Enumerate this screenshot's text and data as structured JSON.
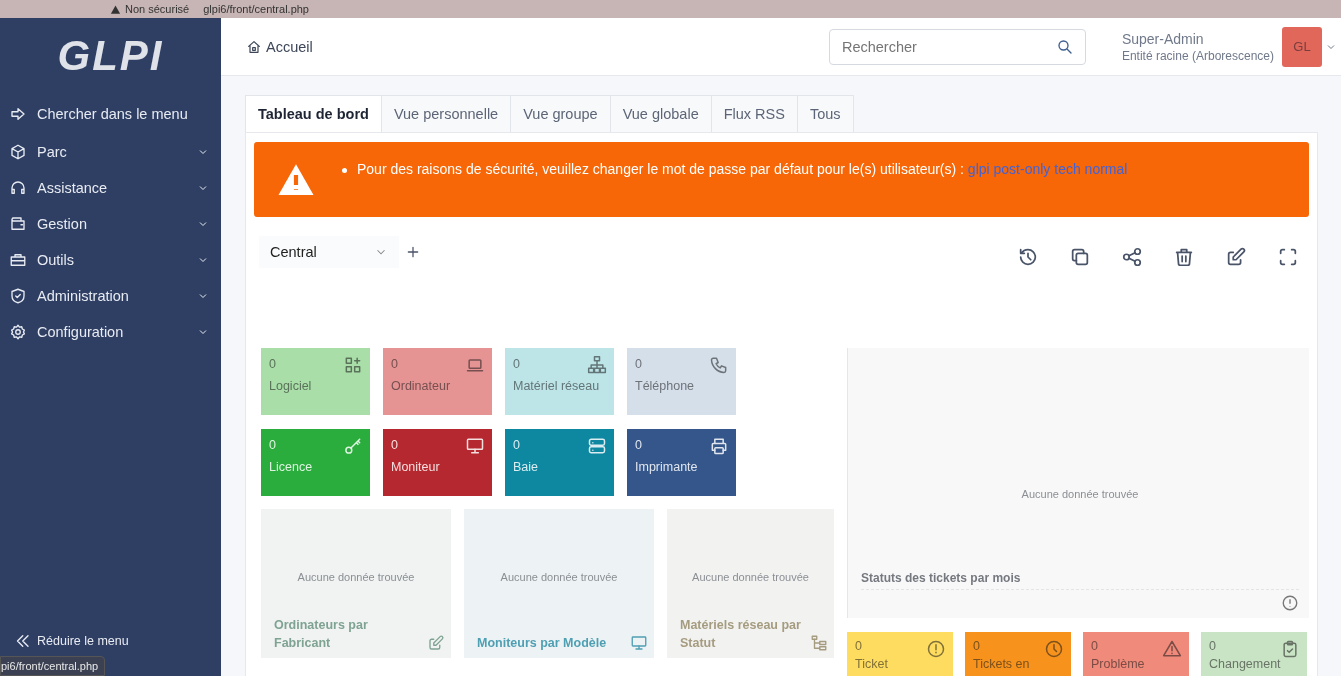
{
  "browser": {
    "security_label": "Non sécurisé",
    "url": "glpi6/front/central.php"
  },
  "sidebar": {
    "logo": "GLPI",
    "search_label": "Chercher dans le menu",
    "items": [
      {
        "label": "Parc"
      },
      {
        "label": "Assistance"
      },
      {
        "label": "Gestion"
      },
      {
        "label": "Outils"
      },
      {
        "label": "Administration"
      },
      {
        "label": "Configuration"
      }
    ],
    "collapse_label": "Réduire le menu"
  },
  "header": {
    "breadcrumb": "Accueil",
    "search": {
      "placeholder": "Rechercher"
    },
    "user_name": "Super-Admin",
    "entity": "Entité racine (Arborescence)",
    "avatar_initials": "GL"
  },
  "tabs": [
    {
      "label": "Tableau de bord",
      "selected": true
    },
    {
      "label": "Vue personnelle",
      "selected": false
    },
    {
      "label": "Vue groupe",
      "selected": false
    },
    {
      "label": "Vue globale",
      "selected": false
    },
    {
      "label": "Flux RSS",
      "selected": false
    },
    {
      "label": "Tous",
      "selected": false
    }
  ],
  "alert": {
    "message": "Pour des raisons de sécurité, veuillez changer le mot de passe par défaut pour le(s) utilisateur(s) :",
    "link": "glpi post-only tech normal"
  },
  "dashboard_select": {
    "value": "Central"
  },
  "tiles": [
    {
      "count": "0",
      "label": "Logiciel",
      "color": "#a9dea9"
    },
    {
      "count": "0",
      "label": "Ordinateur",
      "color": "#e69393"
    },
    {
      "count": "0",
      "label": "Matériel réseau",
      "color": "#bde5e8"
    },
    {
      "count": "0",
      "label": "Téléphone",
      "color": "#d5dfea"
    },
    {
      "count": "0",
      "label": "Licence",
      "color": "#2aad3d"
    },
    {
      "count": "0",
      "label": "Moniteur",
      "color": "#b5282f"
    },
    {
      "count": "0",
      "label": "Baie",
      "color": "#0e87a0"
    },
    {
      "count": "0",
      "label": "Imprimante",
      "color": "#34568b"
    }
  ],
  "cards": [
    {
      "title": "Ordinateurs par Fabricant",
      "empty_text": "Aucune donnée trouvée",
      "color": "#7fa393"
    },
    {
      "title": "Moniteurs par Modèle",
      "empty_text": "Aucune donnée trouvée",
      "color": "#4f9fb3"
    },
    {
      "title": "Matériels réseau par Statut",
      "empty_text": "Aucune donnée trouvée",
      "color": "#a59c80"
    }
  ],
  "ticket_chart": {
    "title": "Statuts des tickets par mois",
    "empty_text": "Aucune donnée trouvée"
  },
  "ticket_tiles": [
    {
      "count": "0",
      "label": "Ticket",
      "color": "#fedc5f"
    },
    {
      "count": "0",
      "label": "Tickets en",
      "color": "#f7931d"
    },
    {
      "count": "0",
      "label": "Problème",
      "color": "#f08a7a"
    },
    {
      "count": "0",
      "label": "Changement",
      "color": "#c9e3c5"
    }
  ],
  "status_tooltip": "pi6/front/central.php"
}
